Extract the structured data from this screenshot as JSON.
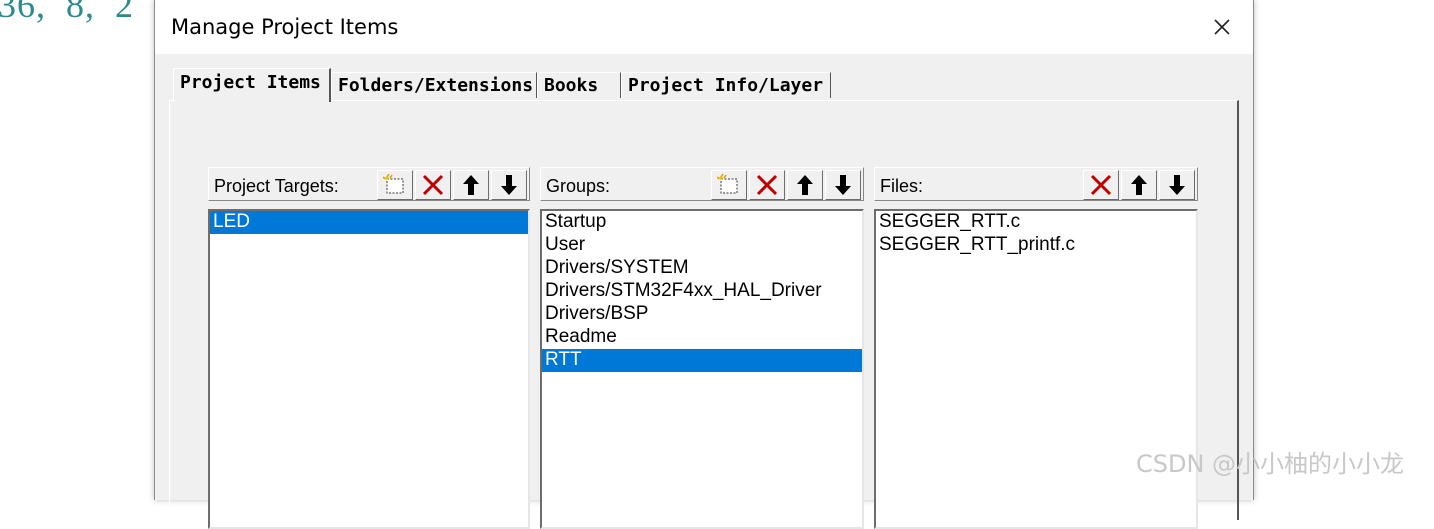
{
  "background": {
    "code_left": "36,  8,  2",
    "code_right": ""
  },
  "dialog": {
    "title": "Manage Project Items",
    "close_icon": "close-icon"
  },
  "tabs": [
    {
      "label": "Project Items",
      "active": true
    },
    {
      "label": "Folders/Extensions",
      "active": false
    },
    {
      "label": "Books",
      "active": false
    },
    {
      "label": "Project Info/Layer",
      "active": false
    }
  ],
  "targets": {
    "label": "Project Targets:",
    "items": [
      "LED"
    ],
    "selected": "LED"
  },
  "groups": {
    "label": "Groups:",
    "items": [
      "Startup",
      "User",
      "Drivers/SYSTEM",
      "Drivers/STM32F4xx_HAL_Driver",
      "Drivers/BSP",
      "Readme",
      "RTT"
    ],
    "selected": "RTT"
  },
  "files": {
    "label": "Files:",
    "items": [
      "SEGGER_RTT.c",
      "SEGGER_RTT_printf.c"
    ]
  },
  "icons": {
    "new": "new-item-icon",
    "delete": "delete-icon",
    "up": "move-up-icon",
    "down": "move-down-icon"
  },
  "colors": {
    "selection": "#0078d7",
    "delete_red": "#c00000"
  },
  "watermark": "CSDN @小小柚的小小龙"
}
